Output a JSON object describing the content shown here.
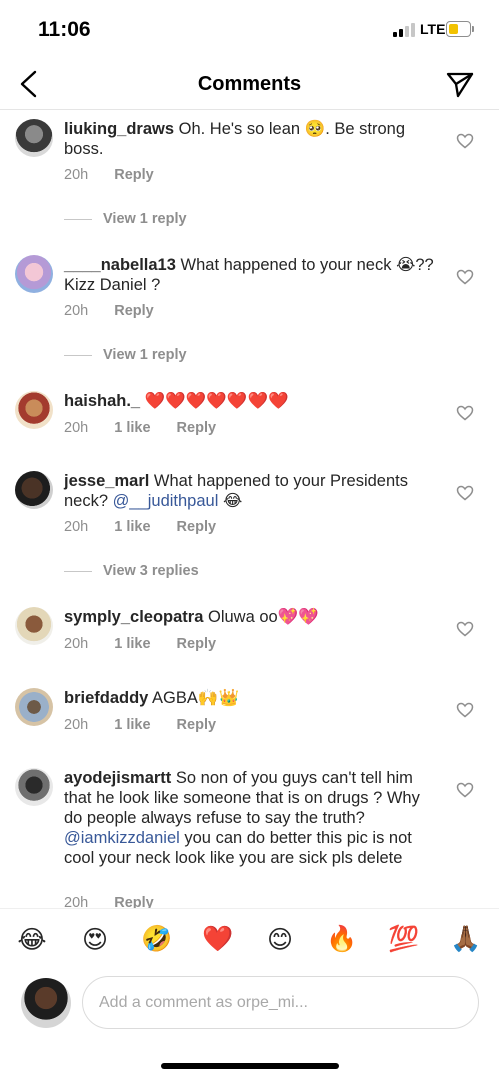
{
  "status": {
    "time": "11:06",
    "network": "LTE",
    "battery_level": 0.45,
    "battery_color": "#f2c200"
  },
  "nav": {
    "title": "Comments",
    "back_icon": "chevron-left-icon",
    "send_icon": "paper-plane-icon"
  },
  "comments": [
    {
      "username": "liuking_draws",
      "text_parts": [
        "Oh. He's so lean ",
        "🥺",
        ". Be strong boss."
      ],
      "time": "20h",
      "likes": "",
      "reply_label": "Reply",
      "view_replies": "View 1 reply"
    },
    {
      "username": "____nabella13",
      "text_parts": [
        "What happened to your neck ",
        "😭",
        "??Kizz Daniel ?"
      ],
      "time": "20h",
      "likes": "",
      "reply_label": "Reply",
      "view_replies": "View 1 reply"
    },
    {
      "username": "haishah._",
      "text_parts": [
        "❤️❤️❤️❤️❤️❤️❤️"
      ],
      "time": "20h",
      "likes": "1 like",
      "reply_label": "Reply",
      "view_replies": ""
    },
    {
      "username": "jesse_marl",
      "text_parts": [
        "What happened to your Presidents neck? ",
        "@__judithpaul",
        " 😂"
      ],
      "time": "20h",
      "likes": "1 like",
      "reply_label": "Reply",
      "view_replies": "View 3 replies"
    },
    {
      "username": "symply_cleopatra",
      "text_parts": [
        "Oluwa oo",
        "💖💖"
      ],
      "time": "20h",
      "likes": "1 like",
      "reply_label": "Reply",
      "view_replies": ""
    },
    {
      "username": "briefdaddy",
      "text_parts": [
        "AGBA",
        "🙌👑"
      ],
      "time": "20h",
      "likes": "1 like",
      "reply_label": "Reply",
      "view_replies": ""
    },
    {
      "username": "ayodejismartt",
      "text_parts": [
        "So non of you guys can't tell him that he look like someone that is on drugs ? Why do people always refuse to say the truth? ",
        "@iamkizzdaniel",
        "  you can do better this pic is not cool your neck look like you are sick pls delete"
      ],
      "time": "20h",
      "likes": "",
      "reply_label": "Reply",
      "view_replies": ""
    }
  ],
  "emoji_bar": [
    "😂",
    "😍",
    "🤣",
    "❤️",
    "😊",
    "🔥",
    "💯",
    "🙏🏾"
  ],
  "input": {
    "placeholder": "Add a comment as orpe_mi..."
  },
  "colors": {
    "mention": "#385898",
    "meta": "#8e8e8e",
    "text": "#262626"
  }
}
